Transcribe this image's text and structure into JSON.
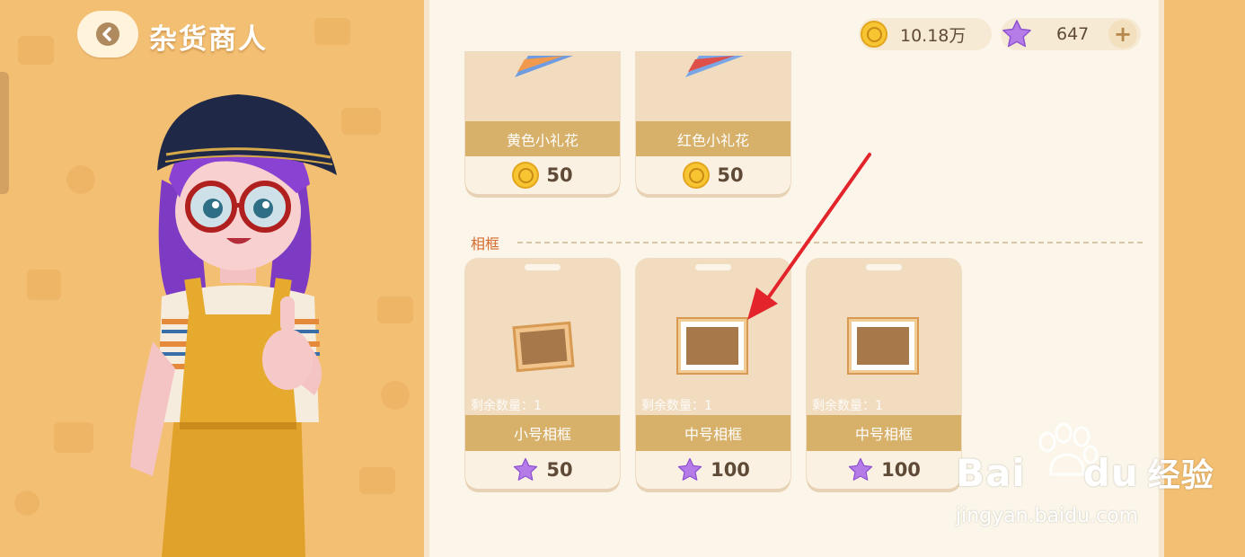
{
  "header": {
    "title": "杂货商人"
  },
  "currency": {
    "coins": "10.18万",
    "stars": "647",
    "add_label": "+"
  },
  "items_top": [
    {
      "name": "黄色小礼花",
      "price": "50",
      "currency": "coin-icon"
    },
    {
      "name": "红色小礼花",
      "price": "50",
      "currency": "coin-icon"
    }
  ],
  "section": {
    "title": "相框"
  },
  "frames": [
    {
      "remaining": "剩余数量：1",
      "name": "小号相框",
      "price": "50",
      "currency": "star-icon"
    },
    {
      "remaining": "剩余数量：1",
      "name": "中号相框",
      "price": "100",
      "currency": "star-icon"
    },
    {
      "remaining": "剩余数量：1",
      "name": "中号相框",
      "price": "100",
      "currency": "star-icon"
    }
  ],
  "watermark": {
    "brand": "Bai",
    "brand2": "du",
    "cn": "经验",
    "url": "jingyan.baidu.com"
  },
  "colors": {
    "bg": "#f3bf72",
    "panel": "#fbf6e9",
    "namebar": "#d7b06a",
    "accent": "#d56b2e",
    "arrow": "#e3242b"
  }
}
